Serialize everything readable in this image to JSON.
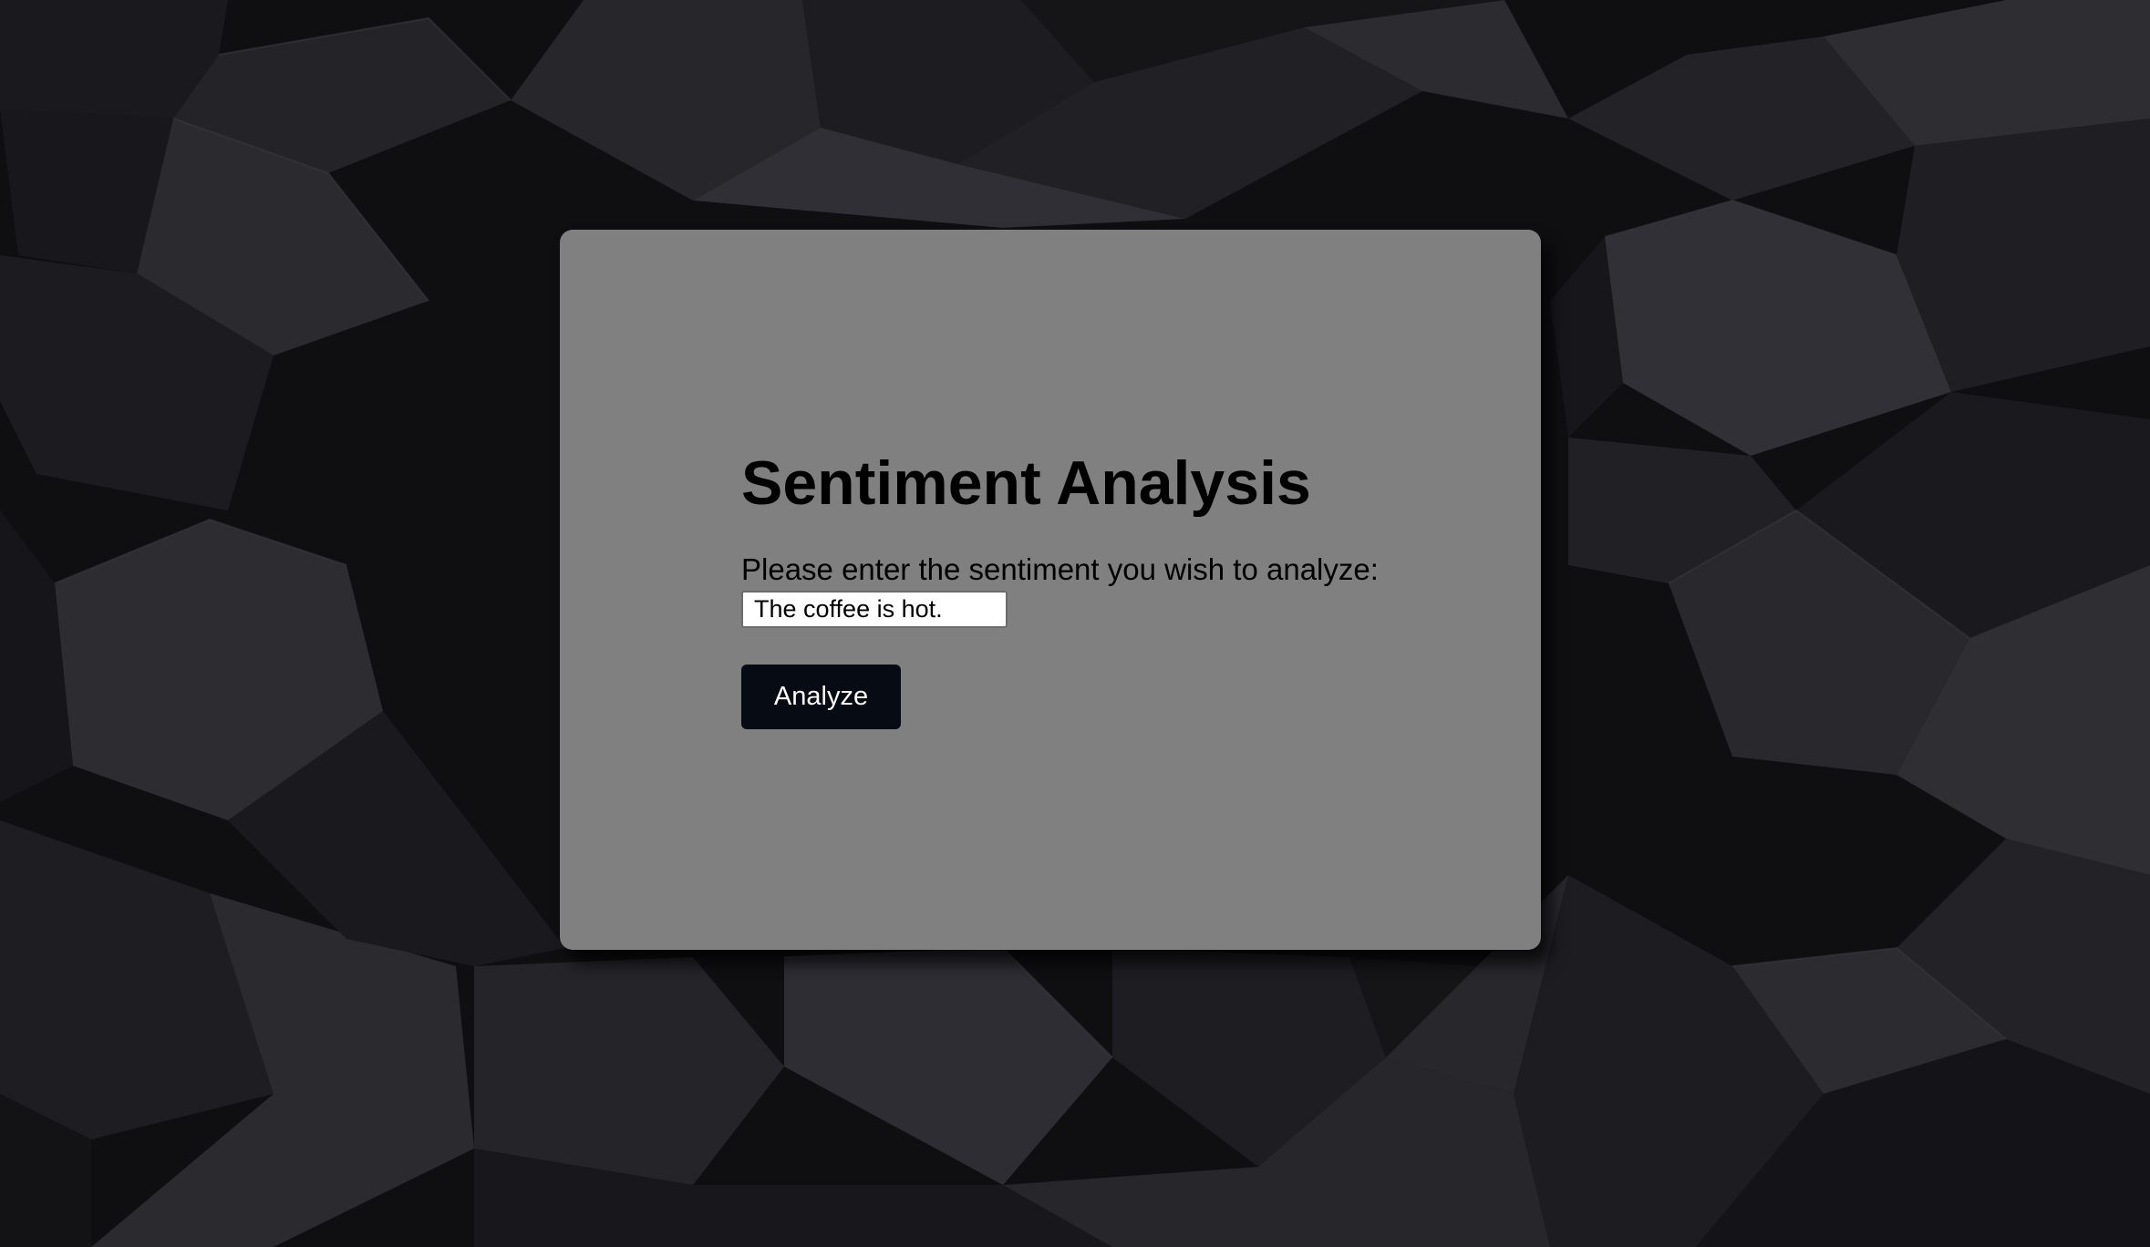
{
  "page": {
    "title": "Sentiment Analysis",
    "prompt": "Please enter the sentiment you wish to analyze:"
  },
  "form": {
    "sentiment_value": "The coffee is hot.",
    "submit_label": "Analyze"
  },
  "colors": {
    "panel_background": "#808080",
    "button_background": "#070b13",
    "button_text": "#ffffff",
    "page_background": "#0e0e11"
  }
}
